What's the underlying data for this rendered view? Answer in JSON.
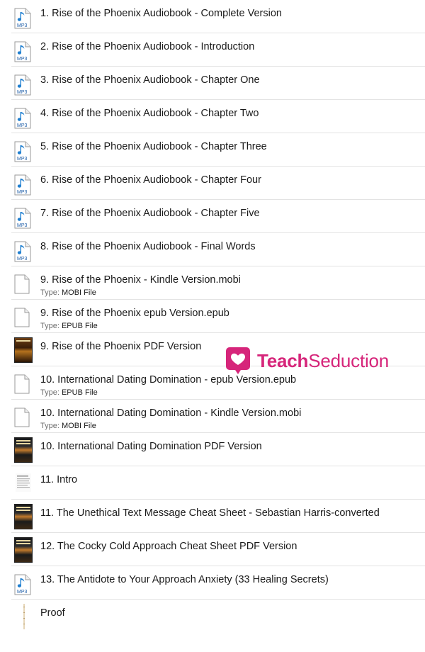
{
  "files": [
    {
      "name": "1. Rise of the Phoenix Audiobook - Complete Version",
      "icon": "mp3-file-icon"
    },
    {
      "name": "2. Rise of the Phoenix Audiobook - Introduction",
      "icon": "mp3-file-icon"
    },
    {
      "name": "3. Rise of the Phoenix Audiobook - Chapter One",
      "icon": "mp3-file-icon"
    },
    {
      "name": "4. Rise of the Phoenix Audiobook - Chapter Two",
      "icon": "mp3-file-icon"
    },
    {
      "name": "5. Rise of the Phoenix Audiobook - Chapter Three",
      "icon": "mp3-file-icon"
    },
    {
      "name": "6. Rise of the Phoenix Audiobook - Chapter Four",
      "icon": "mp3-file-icon"
    },
    {
      "name": "7. Rise of the Phoenix Audiobook - Chapter Five",
      "icon": "mp3-file-icon"
    },
    {
      "name": "8. Rise of the Phoenix Audiobook - Final Words",
      "icon": "mp3-file-icon"
    },
    {
      "name": "9. Rise of the Phoenix - Kindle Version.mobi",
      "icon": "blank-document-icon",
      "type_label": "Type:",
      "type_value": "MOBI File"
    },
    {
      "name": "9. Rise of the Phoenix epub Version.epub",
      "icon": "blank-document-icon",
      "type_label": "Type:",
      "type_value": "EPUB File"
    },
    {
      "name": "9. Rise of the Phoenix PDF Version",
      "icon": "book-cover-thumbnail"
    },
    {
      "name": "10. International Dating Domination - epub Version.epub",
      "icon": "blank-document-icon",
      "type_label": "Type:",
      "type_value": "EPUB File"
    },
    {
      "name": "10. International Dating Domination - Kindle Version.mobi",
      "icon": "blank-document-icon",
      "type_label": "Type:",
      "type_value": "MOBI File"
    },
    {
      "name": "10. International Dating Domination PDF Version",
      "icon": "book-cover-thumbnail"
    },
    {
      "name": "11. Intro",
      "icon": "text-document-thumbnail"
    },
    {
      "name": "11. The Unethical Text Message Cheat Sheet - Sebastian Harris-converted",
      "icon": "book-cover-thumbnail"
    },
    {
      "name": "12. The Cocky Cold Approach Cheat Sheet PDF Version",
      "icon": "book-cover-thumbnail"
    },
    {
      "name": "13. The Antidote to Your Approach Anxiety (33 Healing Secrets)",
      "icon": "mp3-file-icon"
    },
    {
      "name": "Proof",
      "icon": "image-thumbnail"
    }
  ],
  "brand": {
    "part1": "Teach",
    "part2": "Seduction",
    "color": "#d6257a"
  },
  "colors": {
    "mp3_note": "#1f7fd0",
    "divider": "#e3e3e3"
  },
  "icon_text": {
    "mp3": "MP3"
  }
}
